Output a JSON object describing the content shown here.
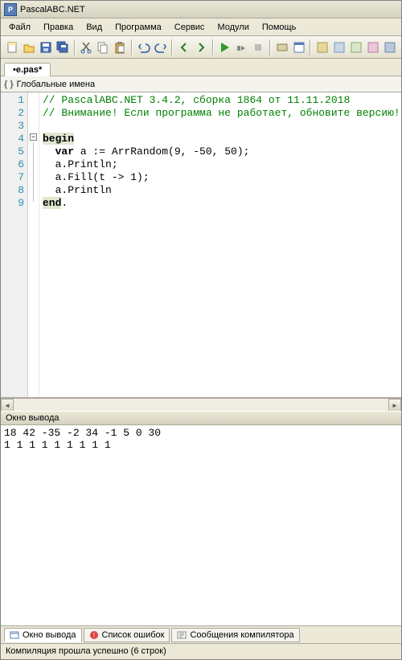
{
  "title": "PascalABC.NET",
  "menu": [
    "Файл",
    "Правка",
    "Вид",
    "Программа",
    "Сервис",
    "Модули",
    "Помощь"
  ],
  "toolbar_icons": [
    "new-file-icon",
    "open-file-icon",
    "save-icon",
    "save-all-icon",
    "cut-icon",
    "copy-icon",
    "paste-icon",
    "undo-icon",
    "redo-icon",
    "navigate-back-icon",
    "navigate-forward-icon",
    "run-icon",
    "step-icon",
    "stop-icon",
    "compile-icon",
    "form-icon",
    "tool1-icon",
    "tool2-icon",
    "tool3-icon",
    "tool4-icon",
    "tool5-icon"
  ],
  "file_tab": "•e.pas*",
  "scope": "Глобальные имена",
  "gutter": [
    "1",
    "2",
    "3",
    "4",
    "5",
    "6",
    "7",
    "8",
    "9"
  ],
  "code": {
    "l1": "// PascalABC.NET 3.4.2, сборка 1864 от 11.11.2018",
    "l2": "// Внимание! Если программа не работает, обновите версию!",
    "l4_begin": "begin",
    "l5_pre": "  ",
    "l5_var": "var",
    "l5_rest": " a := ArrRandom(9, -50, 50);",
    "l6": "  a.Println;",
    "l7": "  a.Fill(t -> 1);",
    "l8": "  a.Println",
    "l9_end": "end",
    "l9_dot": "."
  },
  "output_panel_title": "Окно вывода",
  "output_lines": [
    "18 42 -35 -2 34 -1 5 0 30",
    "1 1 1 1 1 1 1 1 1"
  ],
  "bottom_tabs": [
    {
      "label": "Окно вывода",
      "icon": "output-tab-icon",
      "active": true
    },
    {
      "label": "Список ошибок",
      "icon": "errors-tab-icon",
      "active": false
    },
    {
      "label": "Сообщения компилятора",
      "icon": "messages-tab-icon",
      "active": false
    }
  ],
  "status": "Компиляция прошла успешно (6 строк)"
}
